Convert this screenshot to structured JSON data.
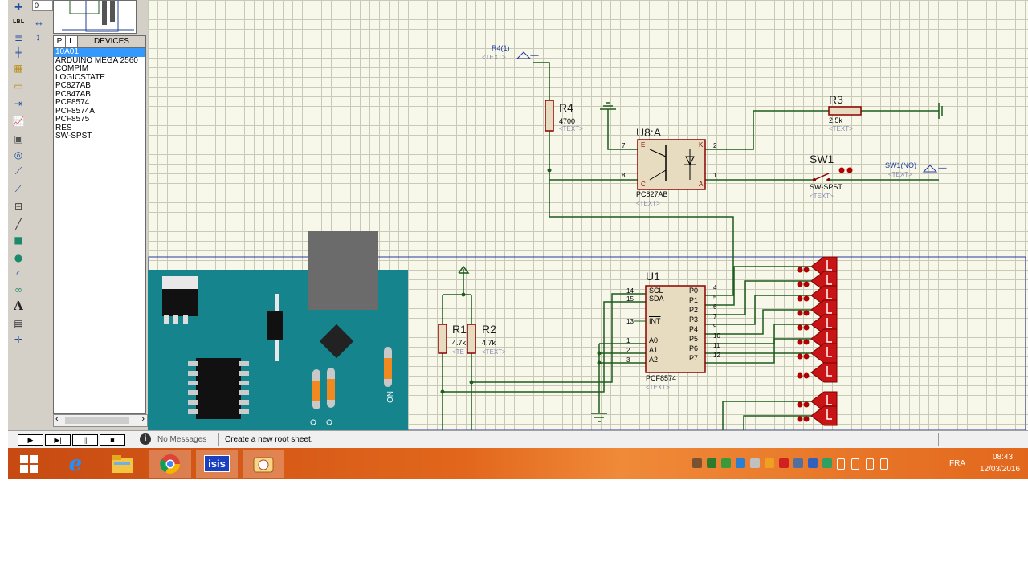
{
  "toolbar": {
    "icons": [
      "junction-dot-icon",
      "wire-label-icon",
      "text-script-icon",
      "bus-icon",
      "subcircuit-icon",
      "terminal-icon",
      "device-pin-icon",
      "graph-icon",
      "tape-recorder-icon",
      "generator-icon",
      "voltage-probe-icon",
      "current-probe-icon",
      "virtual-instrument-icon",
      "line-tool-icon",
      "box-tool-icon",
      "circle-tool-icon",
      "arc-tool-icon",
      "path-tool-icon",
      "text-tool-icon",
      "symbol-tool-icon",
      "marker-tool-icon"
    ],
    "text_icon_glyph": "A",
    "label_icon_glyph": "LBL"
  },
  "side_panel": {
    "rotation_value": "0",
    "pick_button": "P",
    "library_button": "L",
    "devices_header": "DEVICES",
    "devices": [
      "10A01",
      "ARDUINO MEGA 2560",
      "COMPIM",
      "LOGICSTATE",
      "PC827AB",
      "PC847AB",
      "PCF8574",
      "PCF8574A",
      "PCF8575",
      "RES",
      "SW-SPST"
    ],
    "selected_device": "10A01"
  },
  "schematic": {
    "r4_terminal_label": "R4(1)",
    "r4_terminal_text": "<TEXT>",
    "r4_ref": "R4",
    "r4_value": "4700",
    "r4_text": "<TEXT>",
    "r3_ref": "R3",
    "r3_value": "2.5k",
    "r3_text": "<TEXT>",
    "u8_ref": "U8:A",
    "u8_part": "PC827AB",
    "u8_text": "<TEXT>",
    "u8_pins": [
      "7",
      "8",
      "2",
      "1"
    ],
    "u8_corner_labels": [
      "E",
      "K",
      "C",
      "A"
    ],
    "sw1_ref": "SW1",
    "sw1_part": "SW-SPST",
    "sw1_text": "<TEXT>",
    "sw1_terminal_label": "SW1(NO)",
    "sw1_terminal_text": "<TEXT>",
    "u1_ref": "U1",
    "u1_part": "PCF8574",
    "u1_text": "<TEXT>",
    "u1_left_pins": [
      {
        "num": "14",
        "name": "SCL"
      },
      {
        "num": "15",
        "name": "SDA"
      },
      {
        "num": "13",
        "name": "INT"
      },
      {
        "num": "1",
        "name": "A0"
      },
      {
        "num": "2",
        "name": "A1"
      },
      {
        "num": "3",
        "name": "A2"
      }
    ],
    "u1_right_pins": [
      {
        "num": "4",
        "name": "P0"
      },
      {
        "num": "5",
        "name": "P1"
      },
      {
        "num": "6",
        "name": "P2"
      },
      {
        "num": "7",
        "name": "P3"
      },
      {
        "num": "9",
        "name": "P4"
      },
      {
        "num": "10",
        "name": "P5"
      },
      {
        "num": "11",
        "name": "P6"
      },
      {
        "num": "12",
        "name": "P7"
      }
    ],
    "r1_ref": "R1",
    "r1_value": "4.7k",
    "r1_text": "<TE",
    "r2_ref": "R2",
    "r2_value": "4.7k",
    "r2_text": "<TEXT>",
    "arduino_label": "ON",
    "terminal_dash": "-----"
  },
  "status": {
    "play_label": "▶",
    "step_label": "▶|",
    "pause_label": "||",
    "stop_label": "■",
    "messages": "No Messages",
    "hint": "Create a new root sheet."
  },
  "taskbar": {
    "apps": [
      "start-icon",
      "internet-explorer-icon",
      "file-explorer-icon",
      "chrome-icon",
      "isis-icon",
      "proteus-app-icon"
    ],
    "isis_label": "isis",
    "language": "FRA",
    "time": "08:43",
    "date": "12/03/2016"
  },
  "colors": {
    "wire": "#1d5c1d",
    "component_red": "#8b0000",
    "component_fill": "#e8dcc0",
    "arduino_teal": "#15848c",
    "logicstate_red": "#c81414",
    "canvas_bg": "#f7f7ea",
    "selection_blue": "#3399ff"
  }
}
